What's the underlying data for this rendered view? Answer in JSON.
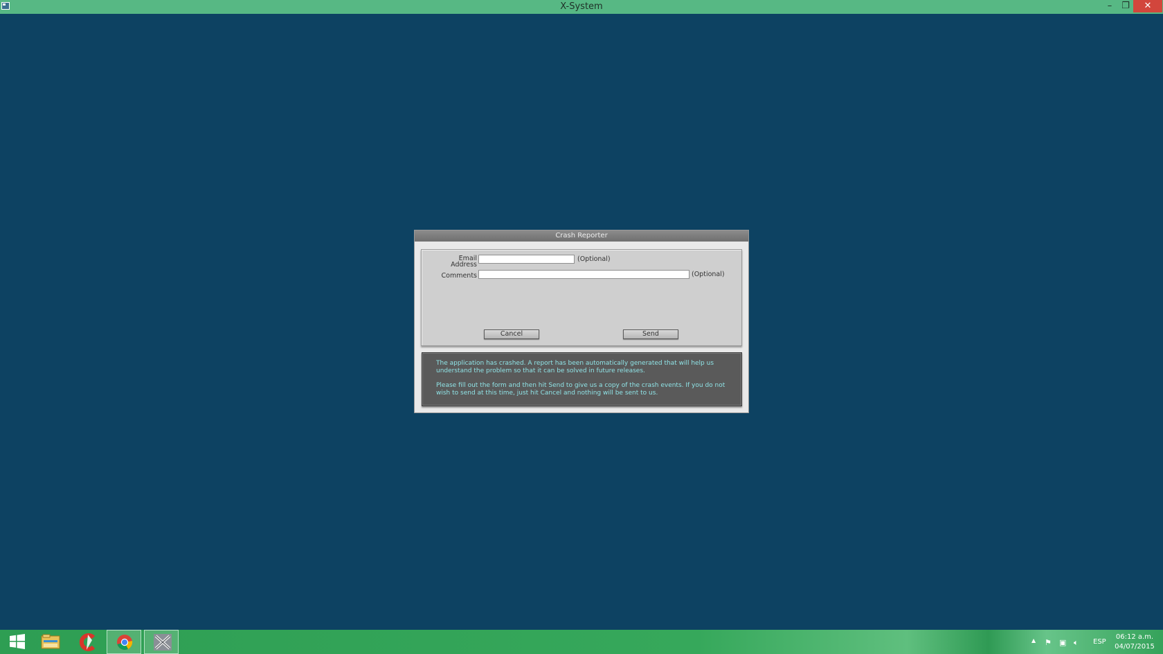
{
  "window": {
    "title": "X-System",
    "minimize_glyph": "–",
    "restore_glyph": "❐",
    "close_glyph": "✕"
  },
  "dialog": {
    "title": "Crash Reporter",
    "email_label": "Email Address",
    "email_value": "",
    "email_optional": "(Optional)",
    "comments_label": "Comments",
    "comments_value": "",
    "comments_optional": "(Optional)",
    "cancel_label": "Cancel",
    "send_label": "Send",
    "message_p1": "The application has crashed. A report has been automatically generated that will help us understand the problem so that it can be solved in future releases.",
    "message_p2": "Please fill out the form and then hit Send to give us a copy of the crash events. If you do not wish to send at this time, just hit Cancel and nothing will be sent to us."
  },
  "taskbar": {
    "items": [
      {
        "icon": "windows-start-icon"
      },
      {
        "icon": "file-explorer-icon"
      },
      {
        "icon": "ccleaner-icon"
      },
      {
        "icon": "chrome-icon"
      },
      {
        "icon": "x-system-icon"
      }
    ],
    "tray": {
      "language": "ESP",
      "time": "06:12 a.m.",
      "date": "04/07/2015"
    }
  },
  "colors": {
    "desktop": "#0d4262",
    "titlebar": "#57b884",
    "taskbar": "#36a85b",
    "message_text": "#8fe3e6"
  }
}
